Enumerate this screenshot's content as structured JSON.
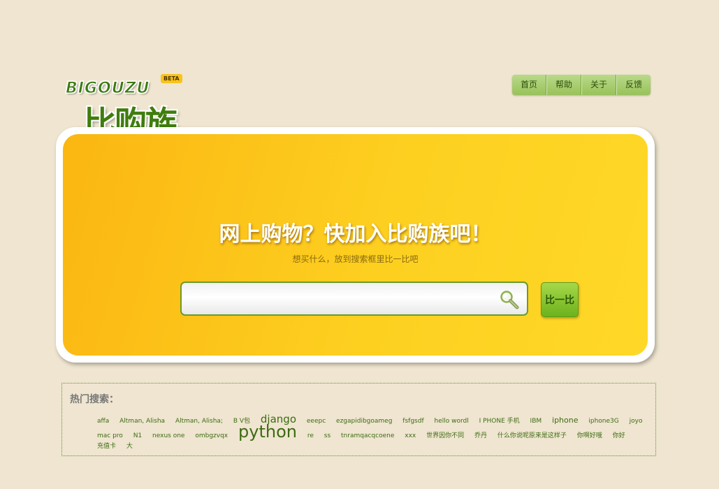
{
  "logo": {
    "english": "BIGOUZU",
    "beta": "BETA",
    "chinese": "比购族"
  },
  "nav": {
    "items": [
      "首页",
      "帮助",
      "关于",
      "反馈"
    ]
  },
  "hero": {
    "title": "网上购物？快加入比购族吧！",
    "subtitle": "想买什么，放到搜索框里比一比吧",
    "search_value": "",
    "search_button": "比一比"
  },
  "hot": {
    "title": "热门搜索：",
    "tags": [
      {
        "text": "affa",
        "size": "normal"
      },
      {
        "text": "Altman, Alisha",
        "size": "normal"
      },
      {
        "text": "Altman, Alisha;",
        "size": "normal"
      },
      {
        "text": "B V包",
        "size": "normal"
      },
      {
        "text": "django",
        "size": "big"
      },
      {
        "text": "eeepc",
        "size": "normal"
      },
      {
        "text": "ezgapidibgoameg",
        "size": "normal"
      },
      {
        "text": "fsfgsdf",
        "size": "normal"
      },
      {
        "text": "hello wordl",
        "size": "normal"
      },
      {
        "text": "I PHONE 手机",
        "size": "normal"
      },
      {
        "text": "IBM",
        "size": "normal"
      },
      {
        "text": "iphone",
        "size": "mid"
      },
      {
        "text": "iphone3G",
        "size": "normal"
      },
      {
        "text": "joyo",
        "size": "normal"
      },
      {
        "text": "mac pro",
        "size": "normal"
      },
      {
        "text": "N1",
        "size": "normal"
      },
      {
        "text": "nexus one",
        "size": "normal"
      },
      {
        "text": "ombgzvqx",
        "size": "normal"
      },
      {
        "text": "python",
        "size": "huge"
      },
      {
        "text": "re",
        "size": "normal"
      },
      {
        "text": "ss",
        "size": "normal"
      },
      {
        "text": "tnramqacqcoene",
        "size": "normal"
      },
      {
        "text": "xxx",
        "size": "normal"
      },
      {
        "text": "世界因你不同",
        "size": "normal"
      },
      {
        "text": "乔丹",
        "size": "normal"
      },
      {
        "text": "什么你说呢原来是这样子",
        "size": "normal"
      },
      {
        "text": "你啊好哦",
        "size": "normal"
      },
      {
        "text": "你好",
        "size": "normal"
      },
      {
        "text": "充值卡",
        "size": "normal"
      },
      {
        "text": "大",
        "size": "normal"
      }
    ]
  },
  "colors": {
    "background": "#efe5d0",
    "hero_start": "#fbb612",
    "hero_end": "#ffd827",
    "brand_green": "#3f7d0e"
  }
}
